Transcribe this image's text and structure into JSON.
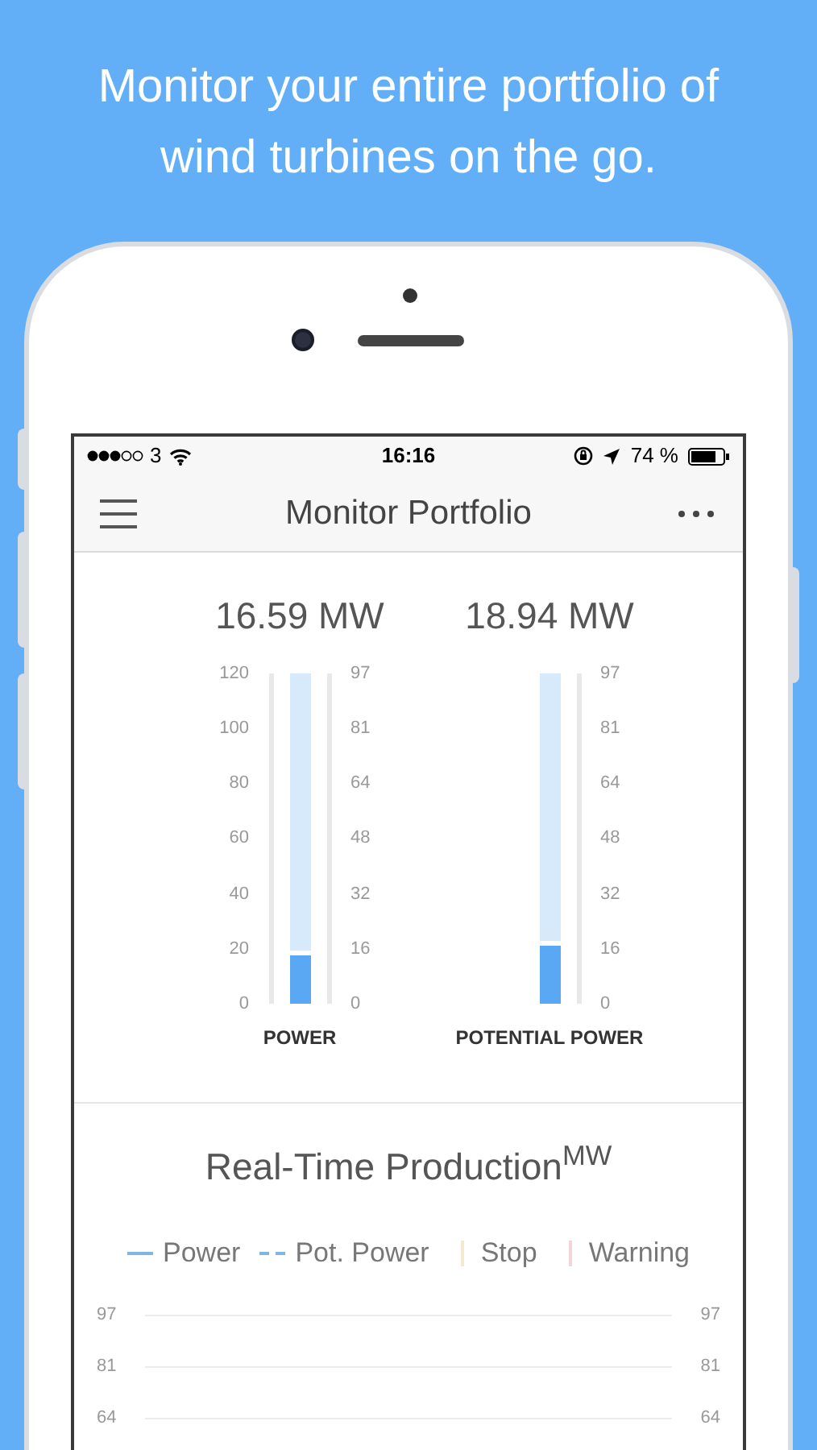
{
  "headline": "Monitor your entire portfolio of wind turbines on the go.",
  "status_bar": {
    "carrier": "3",
    "time": "16:16",
    "battery": "74 %"
  },
  "nav_bar": {
    "title": "Monitor Portfolio"
  },
  "gauges": [
    {
      "value": "16.59 MW",
      "label": "POWER",
      "level": 0.16,
      "left_ticks": [
        "120",
        "100",
        "80",
        "60",
        "40",
        "20",
        "0"
      ],
      "right_ticks": [
        "97",
        "81",
        "64",
        "48",
        "32",
        "16",
        "0"
      ]
    },
    {
      "value": "18.94 MW",
      "label": "POTENTIAL POWER",
      "level": 0.19,
      "right_ticks": [
        "97",
        "81",
        "64",
        "48",
        "32",
        "16",
        "0"
      ]
    }
  ],
  "production": {
    "title": "Real-Time Production$^{MW}$",
    "legend": [
      {
        "kind": "line",
        "label": "Power",
        "color": "#7fb6e6"
      },
      {
        "kind": "dashed",
        "label": "Pot. Power",
        "color": "#7fb6e6"
      },
      {
        "kind": "bar",
        "label": "Stop",
        "color": "#f3ebcd"
      },
      {
        "kind": "bar",
        "label": "Warning",
        "color": "#f1d6d9"
      }
    ],
    "left_ticks": [
      "97",
      "81",
      "64"
    ],
    "right_ticks": [
      "97",
      "81",
      "64"
    ]
  }
}
